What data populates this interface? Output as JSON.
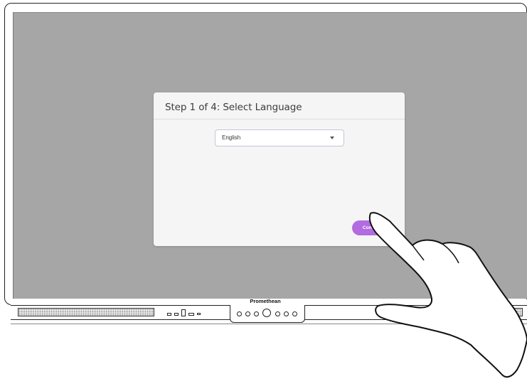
{
  "dialog": {
    "title": "Step 1 of 4: Select Language",
    "language_select": {
      "value": "English"
    },
    "continue_label": "Continue"
  },
  "device": {
    "brand": "Promethean"
  },
  "colors": {
    "screen_bg": "#a6a6a6",
    "dialog_bg": "#f6f5f6",
    "accent": "#b26be0"
  },
  "icons": {
    "dropdown": "chevron-down-icon",
    "power": "power-icon",
    "hand": "pointing-hand-icon"
  }
}
